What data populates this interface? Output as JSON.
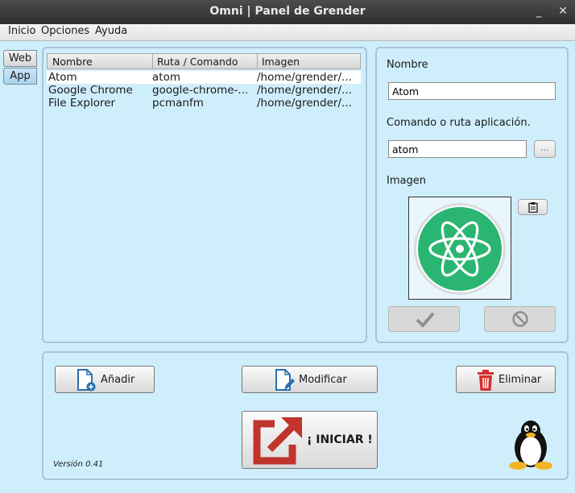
{
  "window": {
    "title": "Omni | Panel de Grender",
    "minimize_label": "_",
    "close_label": "✕"
  },
  "menu": {
    "items": [
      "Inicio",
      "Opciones",
      "Ayuda"
    ]
  },
  "side_tabs": [
    {
      "label": "Web",
      "active": false
    },
    {
      "label": "App",
      "active": true
    }
  ],
  "table": {
    "columns": [
      "Nombre",
      "Ruta / Comando",
      "Imagen"
    ],
    "rows": [
      {
        "name": "Atom",
        "command": "atom",
        "image": "/home/grender/...",
        "selected": true
      },
      {
        "name": "Google Chrome",
        "command": "google-chrome-...",
        "image": "/home/grender/...",
        "selected": false
      },
      {
        "name": "File Explorer",
        "command": "pcmanfm",
        "image": "/home/grender/...",
        "selected": false
      }
    ]
  },
  "form": {
    "name_label": "Nombre",
    "name_value": "Atom",
    "command_label": "Comando o ruta aplicación.",
    "command_value": "atom",
    "browse_label": "...",
    "image_label": "Imagen",
    "paste_icon": "clipboard-icon",
    "preview_icon": "atom-logo",
    "confirm_icon": "checkmark-icon",
    "cancel_icon": "forbidden-icon"
  },
  "actions": {
    "add_label": "Añadir",
    "modify_label": "Modificar",
    "delete_label": "Eliminar",
    "start_label": "¡ INICIAR !",
    "version": "Versión 0.41",
    "mascot_icon": "tux-penguin"
  },
  "colors": {
    "background": "#cfeefc",
    "atom_green": "#2bb572",
    "delete_red": "#d32f2f",
    "start_red": "#c0342c",
    "file_icon_blue": "#2a6fb0"
  }
}
